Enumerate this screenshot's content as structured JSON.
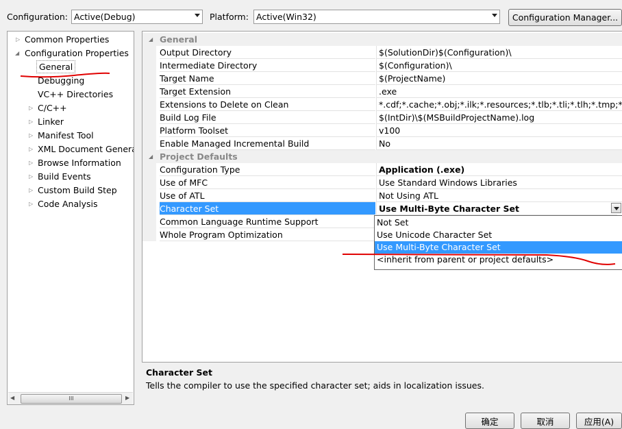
{
  "toolbar": {
    "configuration_label": "Configuration:",
    "configuration_value": "Active(Debug)",
    "platform_label": "Platform:",
    "platform_value": "Active(Win32)",
    "config_manager_label": "Configuration Manager..."
  },
  "tree": {
    "items": [
      {
        "label": "Common Properties"
      },
      {
        "label": "Configuration Properties"
      },
      {
        "label": "General"
      },
      {
        "label": "Debugging"
      },
      {
        "label": "VC++ Directories"
      },
      {
        "label": "C/C++"
      },
      {
        "label": "Linker"
      },
      {
        "label": "Manifest Tool"
      },
      {
        "label": "XML Document Generat"
      },
      {
        "label": "Browse Information"
      },
      {
        "label": "Build Events"
      },
      {
        "label": "Custom Build Step"
      },
      {
        "label": "Code Analysis"
      }
    ],
    "scroll_thumb_label": "III"
  },
  "grid": {
    "categories": [
      {
        "label": "General"
      },
      {
        "label": "Project Defaults"
      }
    ],
    "general_rows": [
      {
        "name": "Output Directory",
        "value": "$(SolutionDir)$(Configuration)\\"
      },
      {
        "name": "Intermediate Directory",
        "value": "$(Configuration)\\"
      },
      {
        "name": "Target Name",
        "value": "$(ProjectName)"
      },
      {
        "name": "Target Extension",
        "value": ".exe"
      },
      {
        "name": "Extensions to Delete on Clean",
        "value": "*.cdf;*.cache;*.obj;*.ilk;*.resources;*.tlb;*.tli;*.tlh;*.tmp;*.rsp;*.pgc"
      },
      {
        "name": "Build Log File",
        "value": "$(IntDir)\\$(MSBuildProjectName).log"
      },
      {
        "name": "Platform Toolset",
        "value": "v100"
      },
      {
        "name": "Enable Managed Incremental Build",
        "value": "No"
      }
    ],
    "default_rows": [
      {
        "name": "Configuration Type",
        "value": "Application (.exe)"
      },
      {
        "name": "Use of MFC",
        "value": "Use Standard Windows Libraries"
      },
      {
        "name": "Use of ATL",
        "value": "Not Using ATL"
      },
      {
        "name": "Character Set",
        "value": "Use Multi-Byte Character Set"
      },
      {
        "name": "Common Language Runtime Support",
        "value": ""
      },
      {
        "name": "Whole Program Optimization",
        "value": ""
      }
    ]
  },
  "dropdown": {
    "options": [
      {
        "label": "Not Set"
      },
      {
        "label": "Use Unicode Character Set"
      },
      {
        "label": "Use Multi-Byte Character Set"
      },
      {
        "label": "<inherit from parent or project defaults>"
      }
    ]
  },
  "description": {
    "title": "Character Set",
    "text": "Tells the compiler to use the specified character set; aids in localization issues."
  },
  "buttons": {
    "ok": "确定",
    "cancel": "取消",
    "apply": "应用(A)"
  },
  "colors": {
    "selection": "#3399ff",
    "annotation": "#e00000"
  }
}
